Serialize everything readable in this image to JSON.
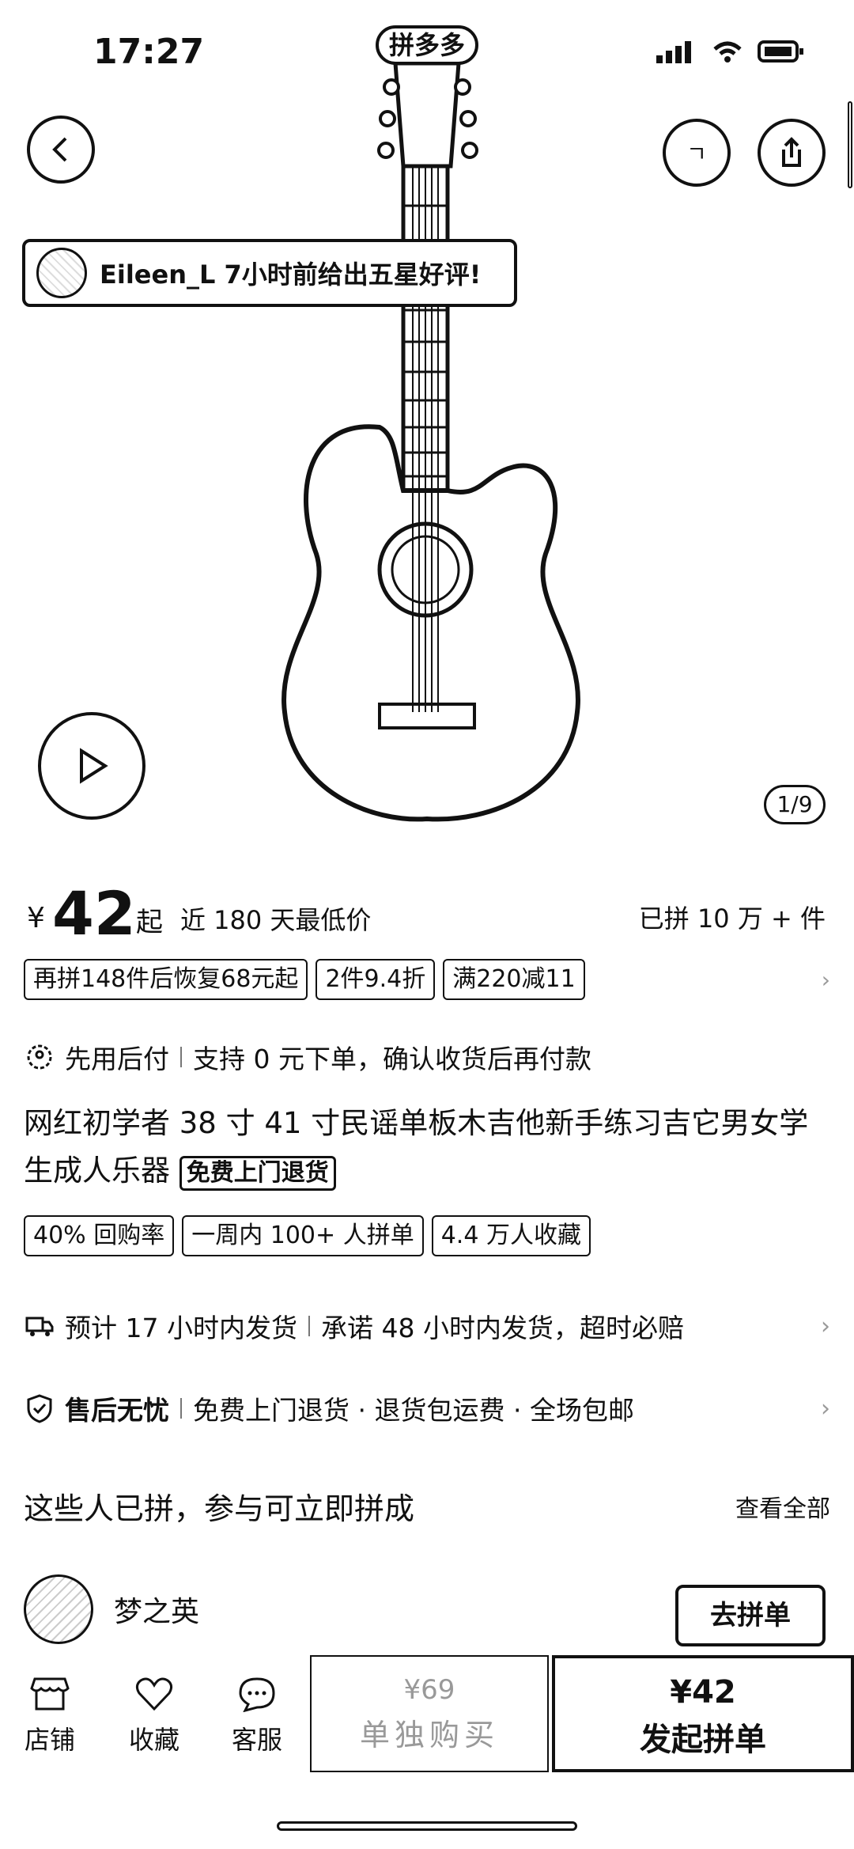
{
  "status_bar": {
    "time": "17:27",
    "app_logo": "拼多多"
  },
  "hero": {
    "review_text": "Eileen_L 7小时前给出五星好评!",
    "page_indicator": "1/9",
    "icons": [
      "back-icon",
      "guitar-image",
      "share-icon",
      "play-icon"
    ]
  },
  "price": {
    "currency": "¥",
    "amount": "42",
    "suffix": "起",
    "note": "近 180 天最低价",
    "sold": "已拼 10 万 + 件"
  },
  "promo_tags": [
    "再拼148件后恢复68元起",
    "2件9.4折",
    "满220减11"
  ],
  "pay_later": {
    "label": "先用后付",
    "desc": "支持 0 元下单，确认收货后再付款"
  },
  "product": {
    "title": "网红初学者 38 寸 41 寸民谣单板木吉他新手练习吉它男女学生成人乐器",
    "badge": "免费上门退货"
  },
  "stat_tags": [
    "40% 回购率",
    "一周内 100+ 人拼单",
    "4.4 万人收藏"
  ],
  "shipping": {
    "label": "预计 17 小时内发货",
    "desc": "承诺 48 小时内发货，超时必赔"
  },
  "after_sale": {
    "label": "售后无忧",
    "desc": "免费上门退货 · 退货包运费 · 全场包邮"
  },
  "group_section": {
    "title": "这些人已拼，参与可立即拼成",
    "view_all": "查看全部",
    "member_name": "梦之英",
    "join_label": "去拼单"
  },
  "bottom_bar": {
    "store": "店铺",
    "favorite": "收藏",
    "service": "客服",
    "single_price": "¥69",
    "single_label": "单独购买",
    "group_price": "¥42",
    "group_label": "发起拼单"
  }
}
